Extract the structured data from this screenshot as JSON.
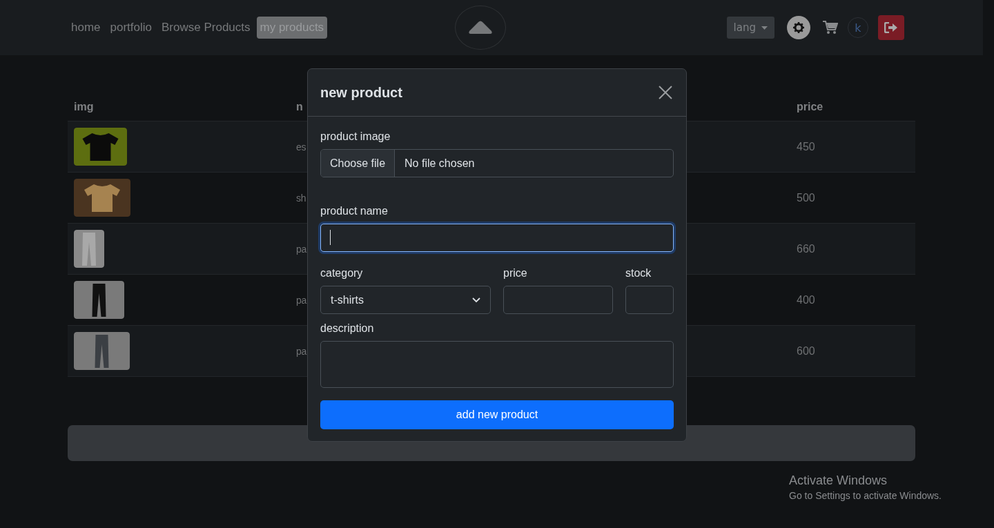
{
  "navbar": {
    "links": [
      {
        "label": "home",
        "selected": false
      },
      {
        "label": "portfolio",
        "selected": false
      },
      {
        "label": "Browse Products",
        "selected": false
      },
      {
        "label": "my products",
        "selected": true
      }
    ],
    "lang_button": "lang",
    "avatar": "k"
  },
  "table": {
    "columns": [
      "img",
      "n",
      "price"
    ],
    "rows": [
      {
        "name": "es",
        "price": "450"
      },
      {
        "name": "sh",
        "price": "500"
      },
      {
        "name": "pa",
        "price": "660"
      },
      {
        "name": "pa",
        "price": "400"
      },
      {
        "name": "pa",
        "price": "600"
      }
    ]
  },
  "modal": {
    "title": "new product",
    "image_label": "product image",
    "file_button": "Choose file",
    "file_status": "No file chosen",
    "name_label": "product name",
    "name_focused": true,
    "category_label": "category",
    "category_value": "t-shirts",
    "price_label": "price",
    "stock_label": "stock",
    "description_label": "description",
    "submit": "add new product"
  },
  "windows_notice": {
    "title": "Activate Windows",
    "subtitle": "Go to Settings to activate Windows."
  }
}
